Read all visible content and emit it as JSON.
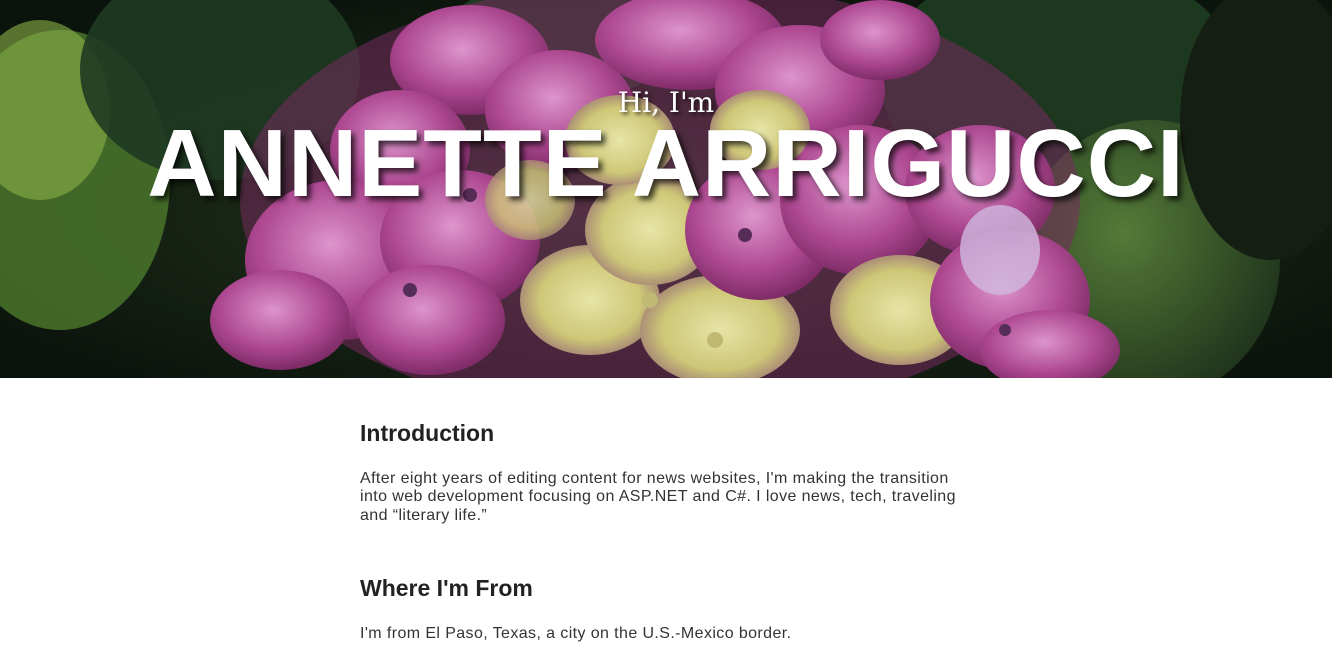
{
  "hero": {
    "greeting": "Hi, I'm",
    "name": "ANNETTE ARRIGUCCI",
    "image_description_icon": "hydrangea-photo",
    "colors": {
      "petal": "#b1408f",
      "petal_light": "#d77bc0",
      "center": "#e6e39a",
      "leaf": "#2c4a2c",
      "background": "#0f1a10"
    }
  },
  "sections": [
    {
      "heading": "Introduction",
      "body": "After eight years of editing content for news websites, I'm making the transition into web development focusing on ASP.NET and C#. I love news, tech, traveling and “literary life.”"
    },
    {
      "heading": "Where I'm From",
      "body": "I'm from El Paso, Texas, a city on the U.S.-Mexico border."
    }
  ]
}
